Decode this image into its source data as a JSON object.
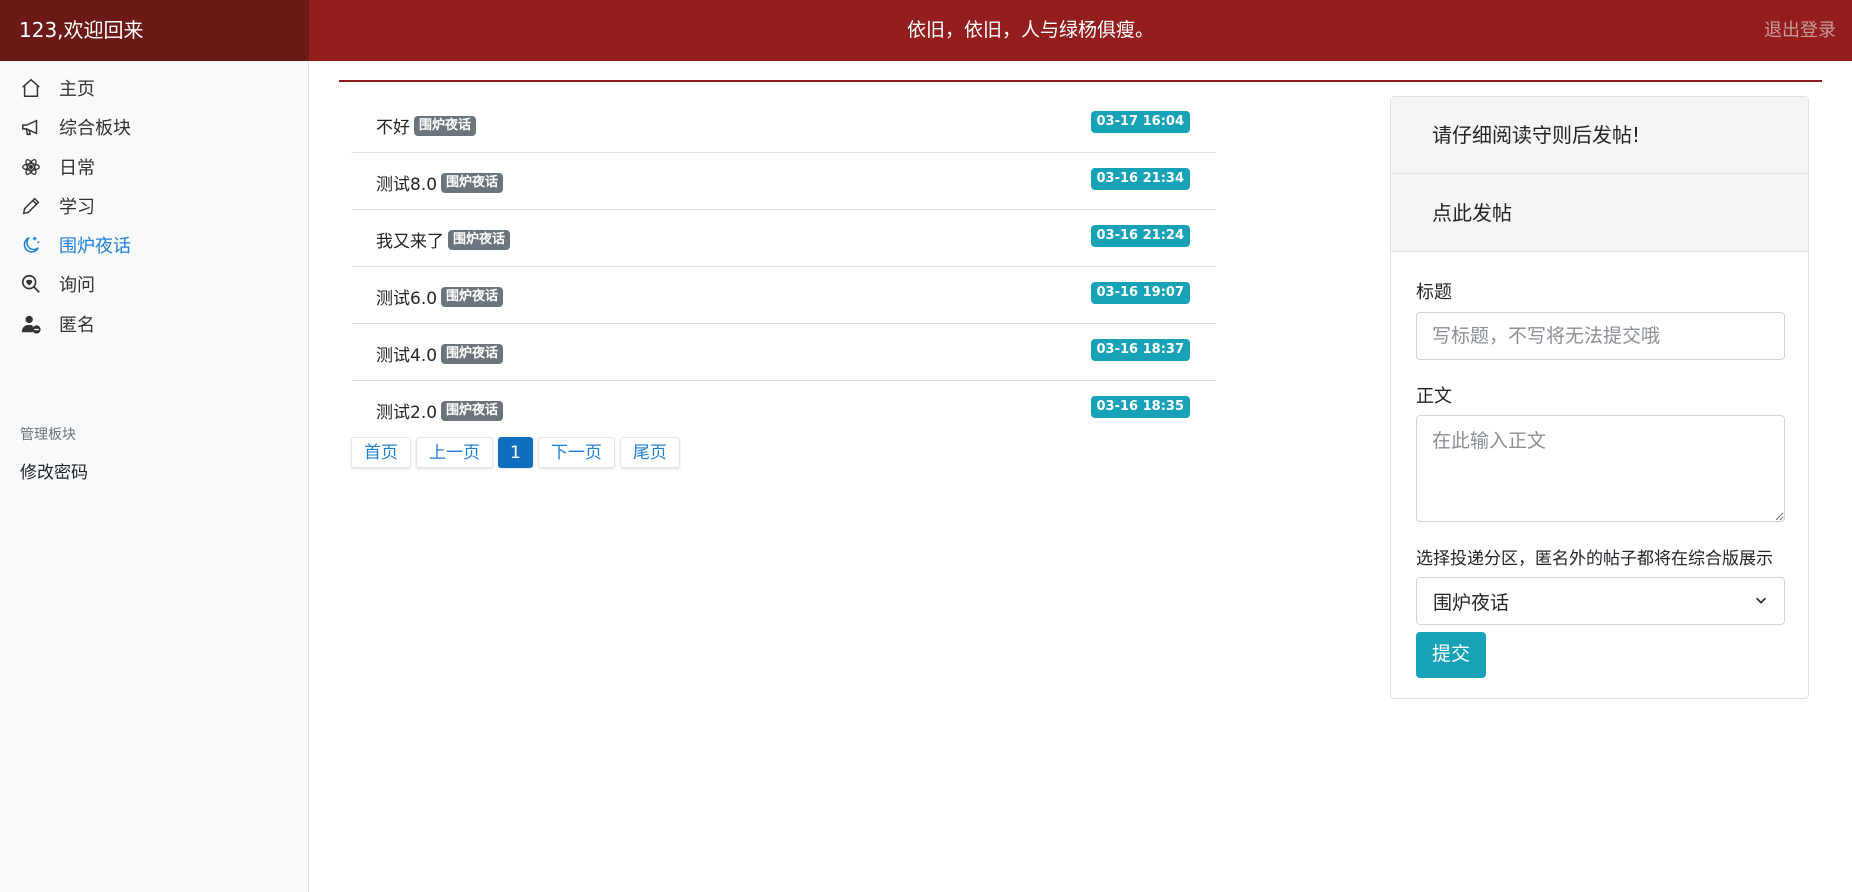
{
  "header": {
    "welcome": "123,欢迎回来",
    "motto": "依旧，依旧，人与绿杨俱瘦。",
    "logout_label": "退出登录"
  },
  "sidebar": {
    "items": [
      {
        "label": "主页",
        "icon": "home-icon"
      },
      {
        "label": "综合板块",
        "icon": "megaphone-icon"
      },
      {
        "label": "日常",
        "icon": "atom-icon"
      },
      {
        "label": "学习",
        "icon": "pencil-icon"
      },
      {
        "label": "围炉夜话",
        "icon": "moon-stars-icon",
        "active": true
      },
      {
        "label": "询问",
        "icon": "search-heart-icon"
      },
      {
        "label": "匿名",
        "icon": "person-dash-icon"
      }
    ],
    "admin_heading": "管理板块",
    "change_password": "修改密码"
  },
  "posts": [
    {
      "title": "不好",
      "tag": "围炉夜话",
      "time": "03-17 16:04"
    },
    {
      "title": "测试8.0",
      "tag": "围炉夜话",
      "time": "03-16 21:34"
    },
    {
      "title": "我又来了",
      "tag": "围炉夜话",
      "time": "03-16 21:24"
    },
    {
      "title": "测试6.0",
      "tag": "围炉夜话",
      "time": "03-16 19:07"
    },
    {
      "title": "测试4.0",
      "tag": "围炉夜话",
      "time": "03-16 18:37"
    },
    {
      "title": "测试2.0",
      "tag": "围炉夜话",
      "time": "03-16 18:35"
    }
  ],
  "pagination": {
    "first": "首页",
    "prev": "上一页",
    "current": "1",
    "next": "下一页",
    "last": "尾页"
  },
  "post_form": {
    "notice": "请仔细阅读守则后发帖!",
    "open_label": "点此发帖",
    "title_label": "标题",
    "title_placeholder": "写标题，不写将无法提交哦",
    "body_label": "正文",
    "body_placeholder": "在此输入正文",
    "section_label": "选择投递分区，匿名外的帖子都将在综合版展示",
    "section_selected": "围炉夜话",
    "submit_label": "提交"
  },
  "colors": {
    "header_bg": "#941e1e",
    "brand_bg": "#6b1a17",
    "accent_blue": "#1d7fd6",
    "time_badge": "#17a2b8",
    "tag_badge": "#6c757d"
  }
}
